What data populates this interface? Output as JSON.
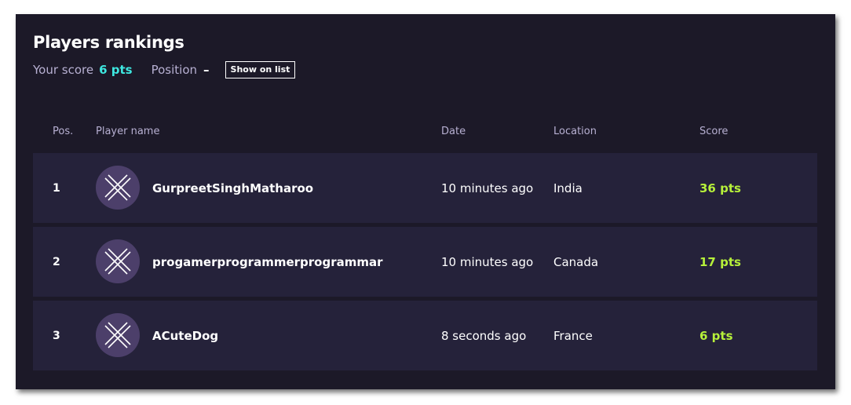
{
  "header": {
    "title": "Players rankings",
    "your_score_label": "Your score",
    "your_score_value": "6 pts",
    "position_label": "Position",
    "position_value": "–",
    "show_on_list_label": "Show on list"
  },
  "table": {
    "columns": {
      "pos": "Pos.",
      "player": "Player name",
      "date": "Date",
      "location": "Location",
      "score": "Score"
    },
    "rows": [
      {
        "pos": "1",
        "player": "GurpreetSinghMatharoo",
        "date": "10 minutes ago",
        "location": "India",
        "score": "36 pts"
      },
      {
        "pos": "2",
        "player": "progamerprogrammerprogrammar",
        "date": "10 minutes ago",
        "location": "Canada",
        "score": "17 pts"
      },
      {
        "pos": "3",
        "player": "ACuteDog",
        "date": "8 seconds ago",
        "location": "France",
        "score": "6 pts"
      }
    ]
  },
  "colors": {
    "panel_bg": "#1c1928",
    "row_bg": "#25223a",
    "avatar_bg": "#4c3f6a",
    "score_accent": "#3ee7e0",
    "points_accent": "#b6f03a",
    "muted_text": "#b7b0d2"
  },
  "icons": {
    "avatar": "crossed-lines-avatar-icon"
  }
}
